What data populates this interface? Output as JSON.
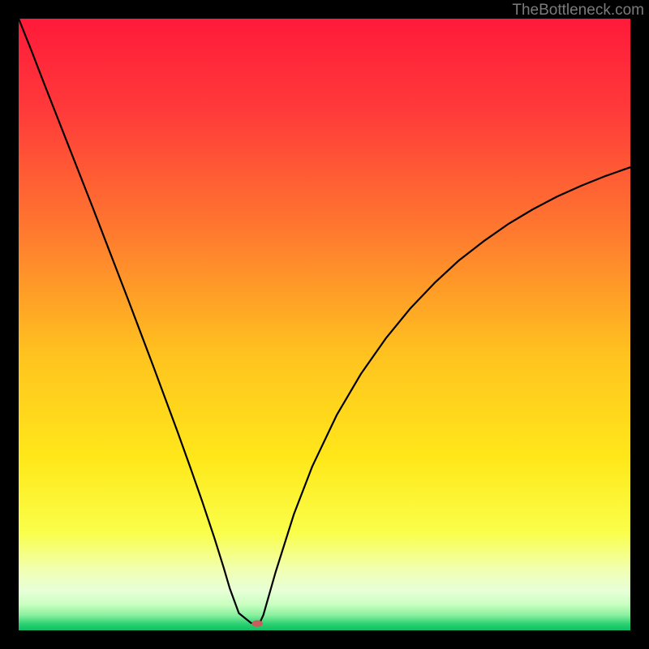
{
  "attribution": "TheBottleneck.com",
  "chart_data": {
    "type": "line",
    "title": "",
    "xlabel": "",
    "ylabel": "",
    "xlim": [
      0,
      100
    ],
    "ylim": [
      0,
      100
    ],
    "grid": false,
    "series": [
      {
        "name": "bottleneck-curve",
        "x": [
          0,
          2,
          4,
          6,
          8,
          10,
          12,
          14,
          16,
          18,
          20,
          22,
          24,
          26,
          28,
          30,
          32,
          33.5,
          34.5,
          36,
          38,
          38.6,
          39,
          39.4,
          40,
          42,
          45,
          48,
          52,
          56,
          60,
          64,
          68,
          72,
          76,
          80,
          84,
          88,
          92,
          96,
          100
        ],
        "y": [
          100,
          95,
          89.8,
          84.7,
          79.6,
          74.5,
          69.4,
          64.2,
          59.0,
          53.8,
          48.5,
          43.2,
          37.8,
          32.4,
          26.8,
          21.1,
          15.1,
          10.3,
          6.9,
          2.8,
          1.2,
          1.1,
          1.1,
          1.2,
          2.5,
          9.5,
          19.0,
          26.8,
          35.2,
          42.0,
          47.7,
          52.6,
          56.8,
          60.5,
          63.6,
          66.4,
          68.8,
          70.9,
          72.7,
          74.3,
          75.7
        ]
      }
    ],
    "marker": {
      "name": "optimal-point",
      "x": 39,
      "y": 1.1,
      "rx": 0.9,
      "ry": 0.55,
      "color": "#c95c5c"
    },
    "background": {
      "type": "vertical-gradient",
      "stops": [
        {
          "offset": 0.0,
          "color": "#ff1a3a"
        },
        {
          "offset": 0.15,
          "color": "#ff3a3a"
        },
        {
          "offset": 0.35,
          "color": "#ff7a2f"
        },
        {
          "offset": 0.55,
          "color": "#ffc31f"
        },
        {
          "offset": 0.72,
          "color": "#ffe81a"
        },
        {
          "offset": 0.84,
          "color": "#faff4a"
        },
        {
          "offset": 0.9,
          "color": "#f1ffb0"
        },
        {
          "offset": 0.935,
          "color": "#e8ffd8"
        },
        {
          "offset": 0.958,
          "color": "#c9ffc0"
        },
        {
          "offset": 0.975,
          "color": "#8af0a0"
        },
        {
          "offset": 0.99,
          "color": "#28d070"
        },
        {
          "offset": 1.0,
          "color": "#0fbf65"
        }
      ]
    }
  }
}
